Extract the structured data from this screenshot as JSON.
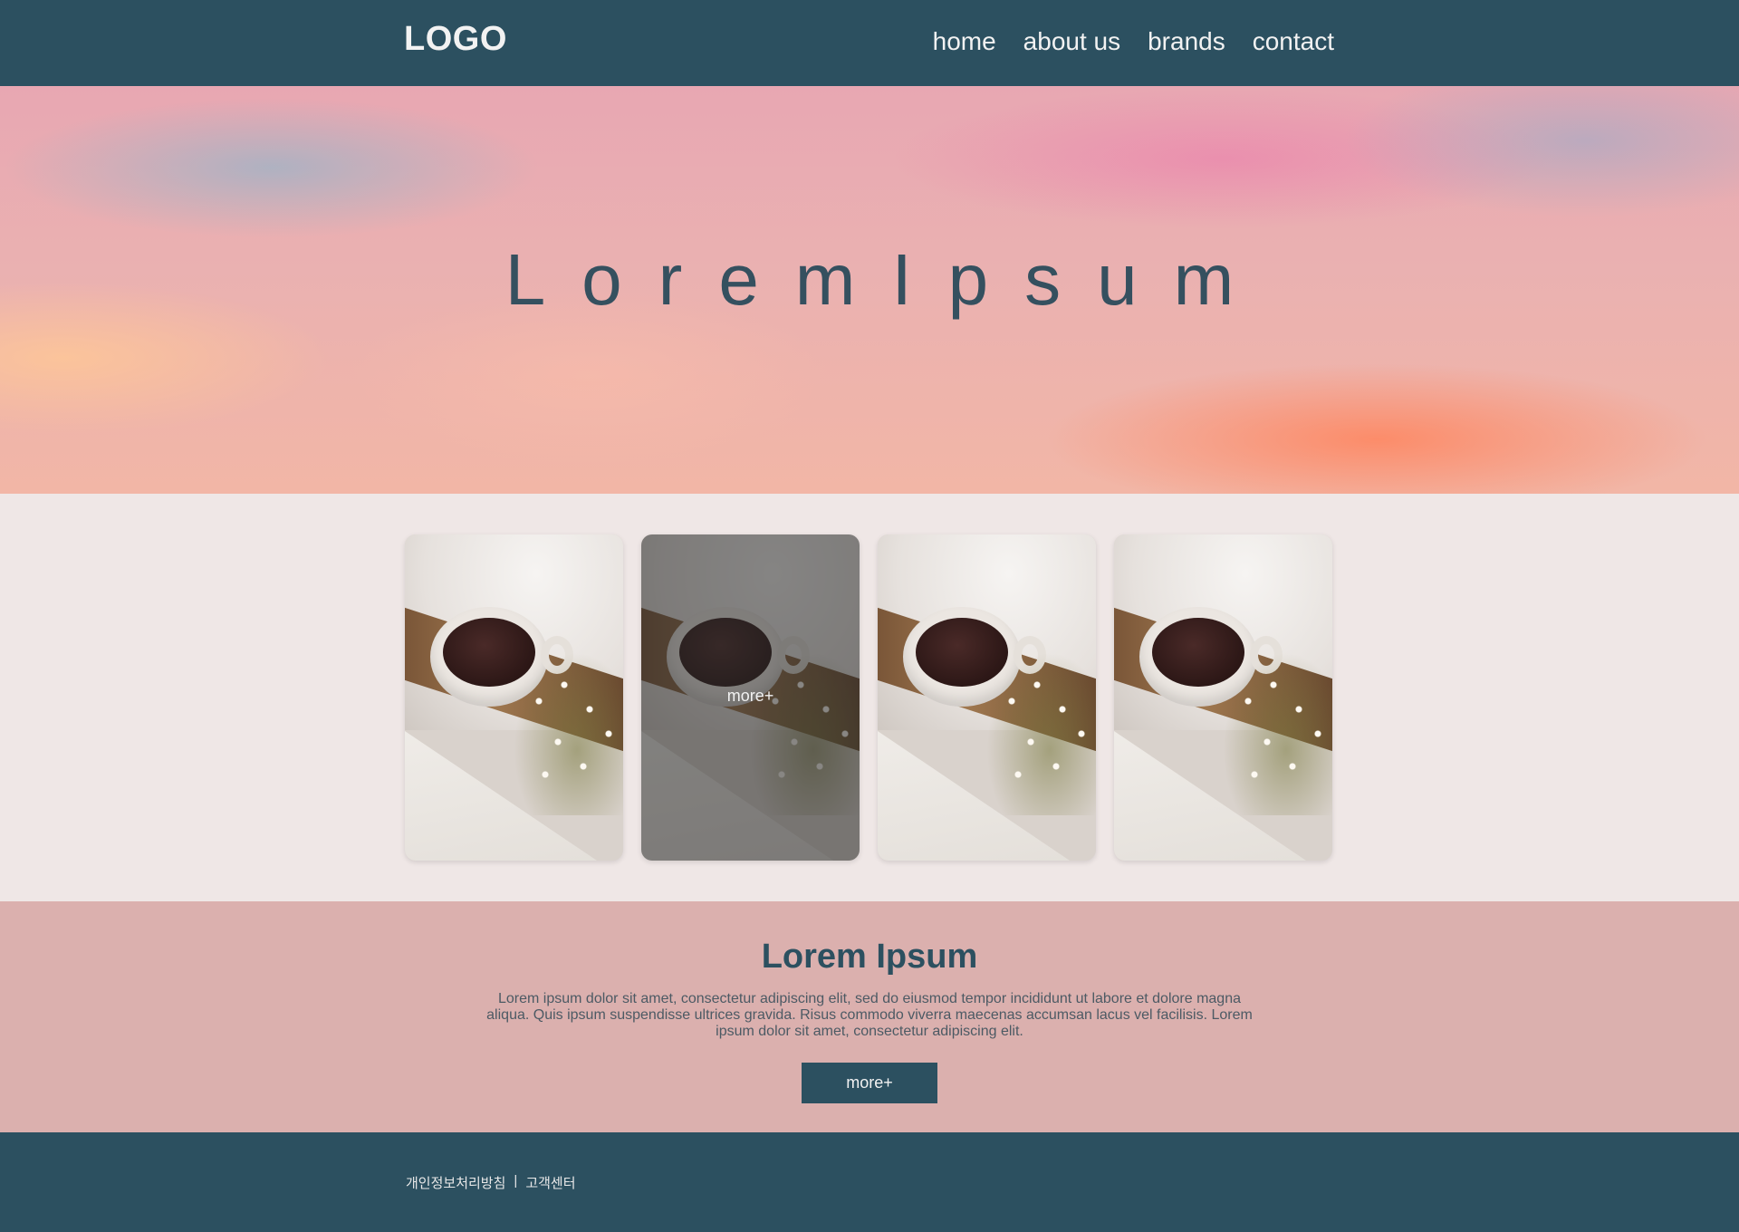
{
  "header": {
    "logo": "LOGO",
    "nav": [
      "home",
      "about us",
      "brands",
      "contact"
    ]
  },
  "hero": {
    "title": "LoremIpsum"
  },
  "cards": {
    "hover_label": "more+"
  },
  "info": {
    "title": "Lorem Ipsum",
    "text": "Lorem ipsum dolor sit amet, consectetur adipiscing elit, sed do eiusmod tempor incididunt ut labore et dolore magna aliqua. Quis ipsum suspendisse ultrices gravida. Risus commodo viverra maecenas accumsan lacus vel facilisis. Lorem ipsum dolor sit amet, consectetur adipiscing elit.",
    "button": "more+"
  },
  "footer": {
    "privacy": "개인정보처리방침",
    "separator": "|",
    "support": "고객센터"
  },
  "colors": {
    "primary": "#2c5060",
    "section_bg": "#efe7e6",
    "info_bg": "#dbb0ae"
  }
}
